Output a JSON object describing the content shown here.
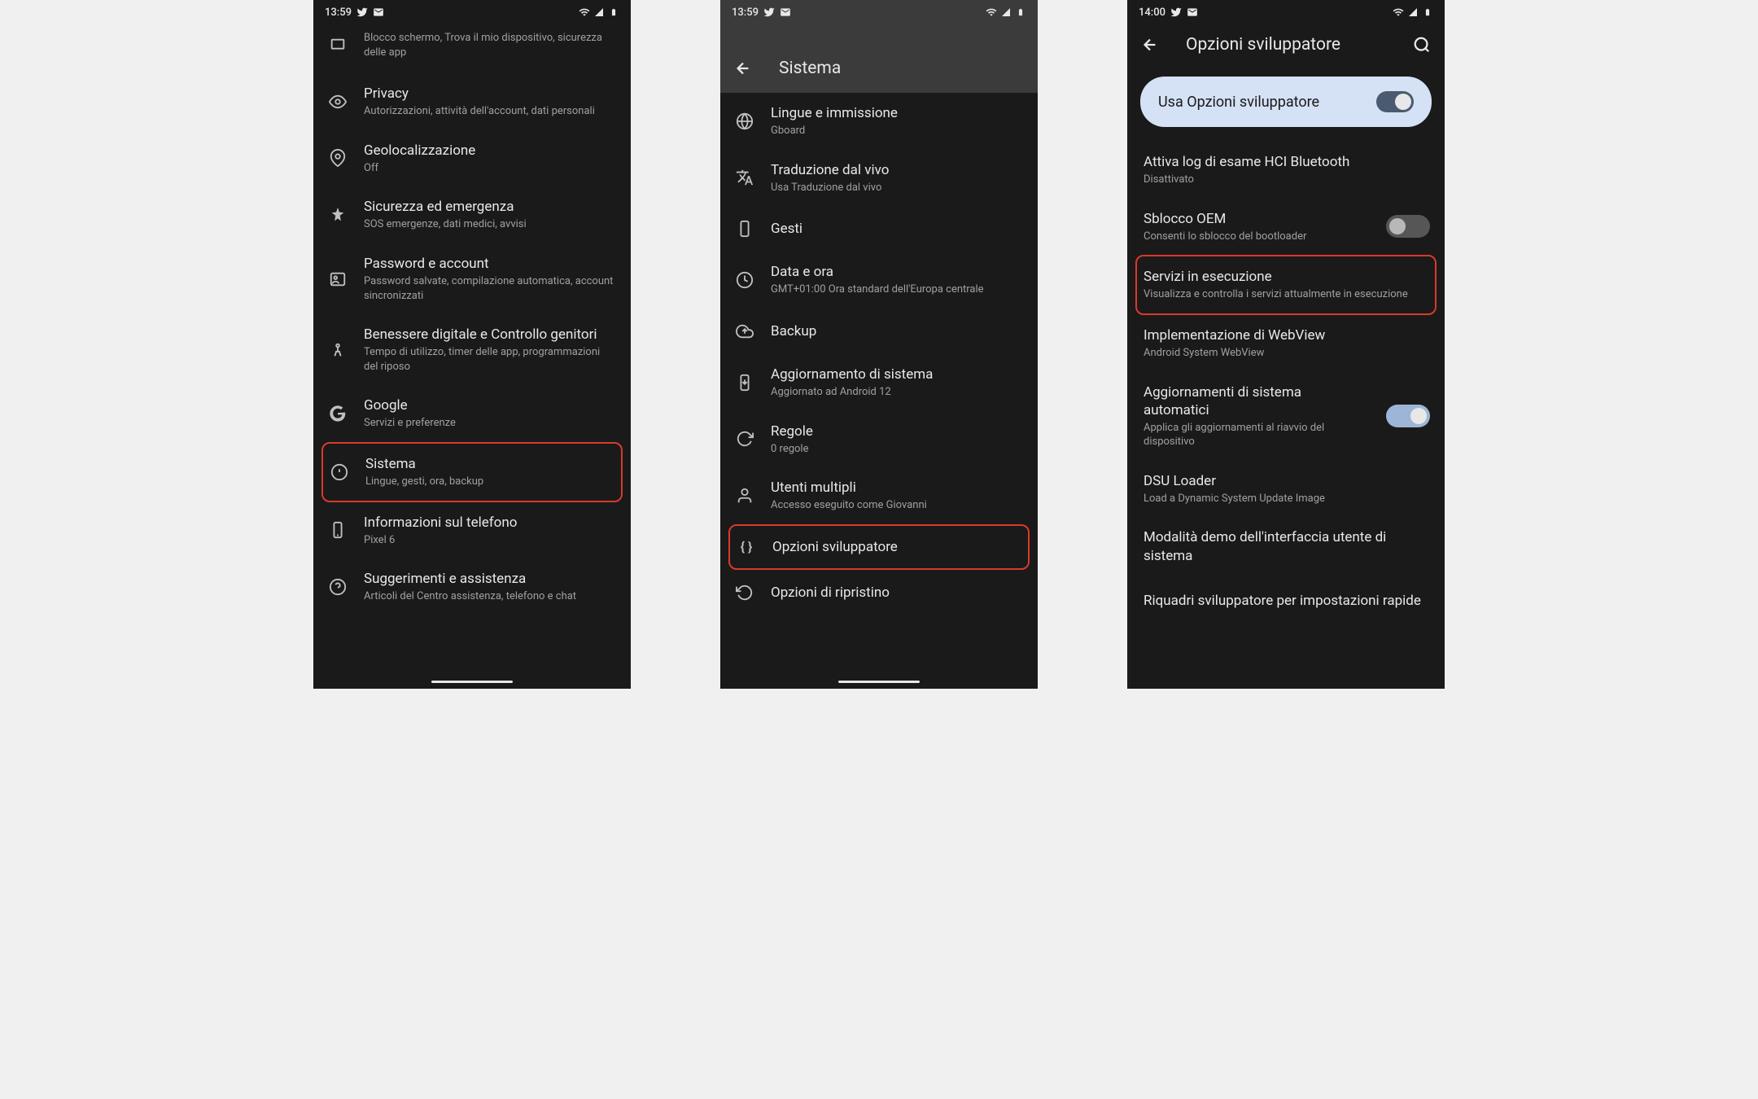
{
  "screen1": {
    "status": {
      "time": "13:59"
    },
    "items": [
      {
        "icon": "security",
        "title": "",
        "sub": "Blocco schermo, Trova il mio dispositivo, sicurezza delle app",
        "partial": true
      },
      {
        "icon": "privacy",
        "title": "Privacy",
        "sub": "Autorizzazioni, attività dell'account, dati personali"
      },
      {
        "icon": "location",
        "title": "Geolocalizzazione",
        "sub": "Off"
      },
      {
        "icon": "emergency",
        "title": "Sicurezza ed emergenza",
        "sub": "SOS emergenze, dati medici, avvisi"
      },
      {
        "icon": "accounts",
        "title": "Password e account",
        "sub": "Password salvate, compilazione automatica, account sincronizzati"
      },
      {
        "icon": "wellbeing",
        "title": "Benessere digitale e Controllo genitori",
        "sub": "Tempo di utilizzo, timer delle app, programmazioni del riposo"
      },
      {
        "icon": "google",
        "title": "Google",
        "sub": "Servizi e preferenze"
      },
      {
        "icon": "system",
        "title": "Sistema",
        "sub": "Lingue, gesti, ora, backup",
        "highlight": true
      },
      {
        "icon": "phone",
        "title": "Informazioni sul telefono",
        "sub": "Pixel 6"
      },
      {
        "icon": "help",
        "title": "Suggerimenti e assistenza",
        "sub": "Articoli del Centro assistenza, telefono e chat"
      }
    ]
  },
  "screen2": {
    "status": {
      "time": "13:59"
    },
    "title": "Sistema",
    "items": [
      {
        "icon": "language",
        "title": "Lingue e immissione",
        "sub": "Gboard"
      },
      {
        "icon": "translate",
        "title": "Traduzione dal vivo",
        "sub": "Usa Traduzione dal vivo"
      },
      {
        "icon": "gestures",
        "title": "Gesti",
        "sub": ""
      },
      {
        "icon": "clock",
        "title": "Data e ora",
        "sub": "GMT+01:00 Ora standard dell'Europa centrale"
      },
      {
        "icon": "backup",
        "title": "Backup",
        "sub": ""
      },
      {
        "icon": "update",
        "title": "Aggiornamento di sistema",
        "sub": "Aggiornato ad Android 12"
      },
      {
        "icon": "rules",
        "title": "Regole",
        "sub": "0 regole"
      },
      {
        "icon": "users",
        "title": "Utenti multipli",
        "sub": "Accesso eseguito come Giovanni"
      },
      {
        "icon": "dev",
        "title": "Opzioni sviluppatore",
        "sub": "",
        "highlight": true
      },
      {
        "icon": "reset",
        "title": "Opzioni di ripristino",
        "sub": ""
      }
    ]
  },
  "screen3": {
    "status": {
      "time": "14:00"
    },
    "title": "Opzioni sviluppatore",
    "master_toggle": {
      "label": "Usa Opzioni sviluppatore",
      "on": true
    },
    "items": [
      {
        "title": "Attiva log di esame HCI Bluetooth",
        "sub": "Disattivato"
      },
      {
        "title": "Sblocco OEM",
        "sub": "Consenti lo sblocco del bootloader",
        "toggle": false
      },
      {
        "title": "Servizi in esecuzione",
        "sub": "Visualizza e controlla i servizi attualmente in esecuzione",
        "highlight": true
      },
      {
        "title": "Implementazione di WebView",
        "sub": "Android System WebView"
      },
      {
        "title": "Aggiornamenti di sistema automatici",
        "sub": "Applica gli aggiornamenti al riavvio del dispositivo",
        "toggle": true
      },
      {
        "title": "DSU Loader",
        "sub": "Load a Dynamic System Update Image"
      },
      {
        "title": "Modalità demo dell'interfaccia utente di sistema",
        "sub": ""
      },
      {
        "title": "Riquadri sviluppatore per impostazioni rapide",
        "sub": ""
      }
    ]
  }
}
